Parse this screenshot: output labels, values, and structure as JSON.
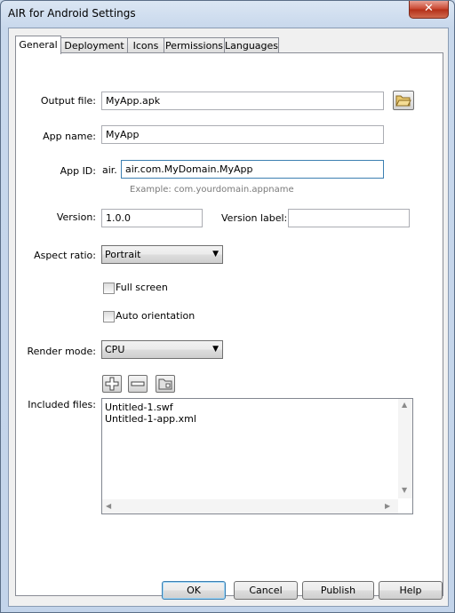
{
  "window": {
    "title": "AIR for Android Settings",
    "close_glyph": "✕"
  },
  "tabs": [
    {
      "label": "General",
      "active": true
    },
    {
      "label": "Deployment"
    },
    {
      "label": "Icons"
    },
    {
      "label": "Permissions"
    },
    {
      "label": "Languages"
    }
  ],
  "general": {
    "output_file_label": "Output file:",
    "output_file_value": "MyApp.apk",
    "app_name_label": "App name:",
    "app_name_value": "MyApp",
    "app_id_label": "App ID:",
    "app_id_prefix": "air.",
    "app_id_value": "air.com.MyDomain.MyApp",
    "app_id_example": "Example: com.yourdomain.appname",
    "version_label": "Version:",
    "version_value": "1.0.0",
    "version_label_label": "Version label:",
    "version_label_value": "",
    "aspect_ratio_label": "Aspect ratio:",
    "aspect_ratio_value": "Portrait",
    "full_screen_label": "Full screen",
    "full_screen_checked": false,
    "auto_orientation_label": "Auto orientation",
    "auto_orientation_checked": false,
    "render_mode_label": "Render mode:",
    "render_mode_value": "CPU",
    "included_files_label": "Included files:",
    "included_files": [
      "Untitled-1.swf",
      "Untitled-1-app.xml"
    ]
  },
  "buttons": {
    "ok": "OK",
    "cancel": "Cancel",
    "publish": "Publish",
    "help": "Help"
  }
}
